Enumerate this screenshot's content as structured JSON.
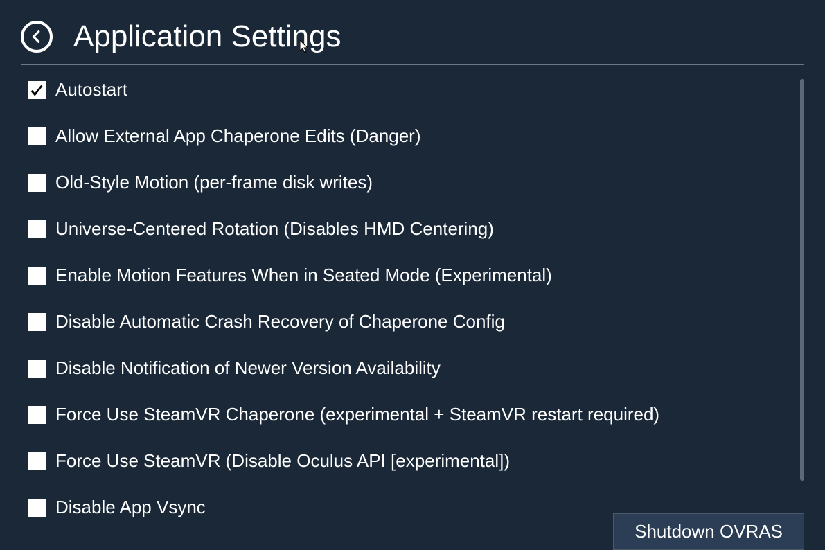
{
  "header": {
    "title": "Application Settings"
  },
  "settings": [
    {
      "label": "Autostart",
      "checked": true
    },
    {
      "label": "Allow External App Chaperone Edits (Danger)",
      "checked": false
    },
    {
      "label": "Old-Style Motion (per-frame disk writes)",
      "checked": false
    },
    {
      "label": "Universe-Centered Rotation (Disables HMD Centering)",
      "checked": false
    },
    {
      "label": "Enable Motion Features When in Seated Mode (Experimental)",
      "checked": false
    },
    {
      "label": "Disable Automatic Crash Recovery of Chaperone Config",
      "checked": false
    },
    {
      "label": "Disable Notification of Newer Version Availability",
      "checked": false
    },
    {
      "label": "Force Use SteamVR Chaperone (experimental + SteamVR restart required)",
      "checked": false
    },
    {
      "label": "Force Use SteamVR (Disable Oculus API [experimental])",
      "checked": false
    },
    {
      "label": "Disable App Vsync",
      "checked": false
    }
  ],
  "footer": {
    "shutdown_label": "Shutdown OVRAS"
  }
}
